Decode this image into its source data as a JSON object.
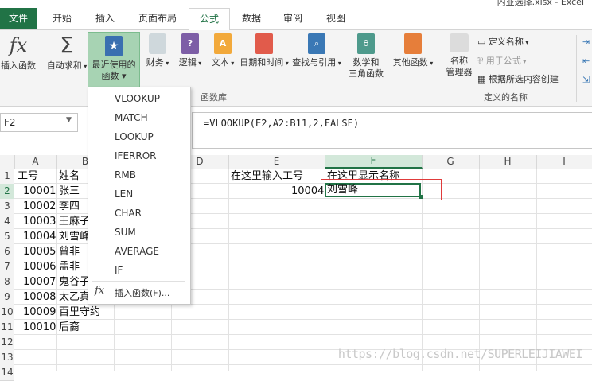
{
  "window": {
    "title": "内並选择.xlsx - Excel"
  },
  "tabs": {
    "file": "文件",
    "home": "开始",
    "insert": "插入",
    "layout": "页面布局",
    "formulas": "公式",
    "data": "数据",
    "review": "审阅",
    "view": "视图"
  },
  "ribbon": {
    "insert_function": "插入函数",
    "autosum": "自动求和",
    "recent": [
      "最近使用的",
      "函数 ▾"
    ],
    "financial": "财务",
    "logical": "逻辑",
    "text": "文本",
    "datetime": "日期和时间",
    "lookup": "查找与引用",
    "math": [
      "数学和",
      "三角函数"
    ],
    "other": "其他函数",
    "name_manager": [
      "名称",
      "管理器"
    ],
    "define_name": "定义名称",
    "use_in_formula": "用于公式",
    "create_from_selection": "根据所选内容创建",
    "group_library": "函数库",
    "group_names": "定义的名称",
    "colors": {
      "accent": "#217346",
      "highlight": "#a7d3b3"
    }
  },
  "formula_bar": {
    "name_box": "F2",
    "formula": "=VLOOKUP(E2,A2:B11,2,FALSE)"
  },
  "dropdown": {
    "items": [
      "VLOOKUP",
      "MATCH",
      "LOOKUP",
      "IFERROR",
      "RMB",
      "LEN",
      "CHAR",
      "SUM",
      "AVERAGE",
      "IF"
    ],
    "insert_function": "插入函数(F)..."
  },
  "grid": {
    "columns": [
      "A",
      "B",
      "C",
      "D",
      "E",
      "F",
      "G",
      "H",
      "I"
    ],
    "rows": [
      "1",
      "2",
      "3",
      "4",
      "5",
      "6",
      "7",
      "8",
      "9",
      "10",
      "11",
      "12",
      "13",
      "14"
    ],
    "header_a": "工号",
    "header_b": "姓名",
    "ids": [
      "10001",
      "10002",
      "10003",
      "10004",
      "10005",
      "10006",
      "10007",
      "10008",
      "10009",
      "10010"
    ],
    "names": [
      "张三",
      "李四",
      "王麻子",
      "刘雪峰",
      "曾非",
      "孟非",
      "鬼谷子",
      "太乙真人",
      "百里守约",
      "后裔"
    ],
    "e1": "在这里输入工号",
    "e2": "10004",
    "f1": "在这里显示名称",
    "f2": "刘雪峰"
  },
  "watermark": "https://blog.csdn.net/SUPERLEIJIAWEI"
}
